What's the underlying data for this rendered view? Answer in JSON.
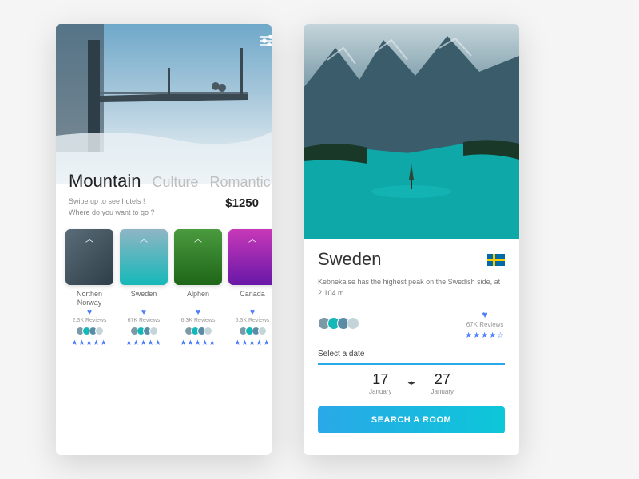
{
  "screen1": {
    "tabs": [
      "Mountain",
      "Culture",
      "Romantic"
    ],
    "activeTab": 0,
    "hint": "Swipe up to see hotels !\nWhere do you want to go ?",
    "price": "$1250",
    "cards": [
      {
        "name": "Northen Norway",
        "reviews": "2.3K Reviews",
        "bg": "linear-gradient(135deg,#5a6c78,#2e3e48)"
      },
      {
        "name": "Sweden",
        "reviews": "67K Reviews",
        "bg": "linear-gradient(180deg,#8fb5c5,#15b8b8)"
      },
      {
        "name": "Alphen",
        "reviews": "6.3K Reviews",
        "bg": "linear-gradient(180deg,#4a9a3e,#1e6618)"
      },
      {
        "name": "Canada",
        "reviews": "6.3K Reviews",
        "bg": "linear-gradient(180deg,#c838b8,#6818a8)"
      }
    ]
  },
  "screen2": {
    "title": "Sweden",
    "desc": "Kebnekaise has the highest peak on the Swedish side, at 2,104 m",
    "reviews": "67K Reviews",
    "selectLabel": "Select a date",
    "dateFrom": {
      "day": "17",
      "month": "January"
    },
    "dateTo": {
      "day": "27",
      "month": "January"
    },
    "cta": "SEARCH A ROOM"
  }
}
